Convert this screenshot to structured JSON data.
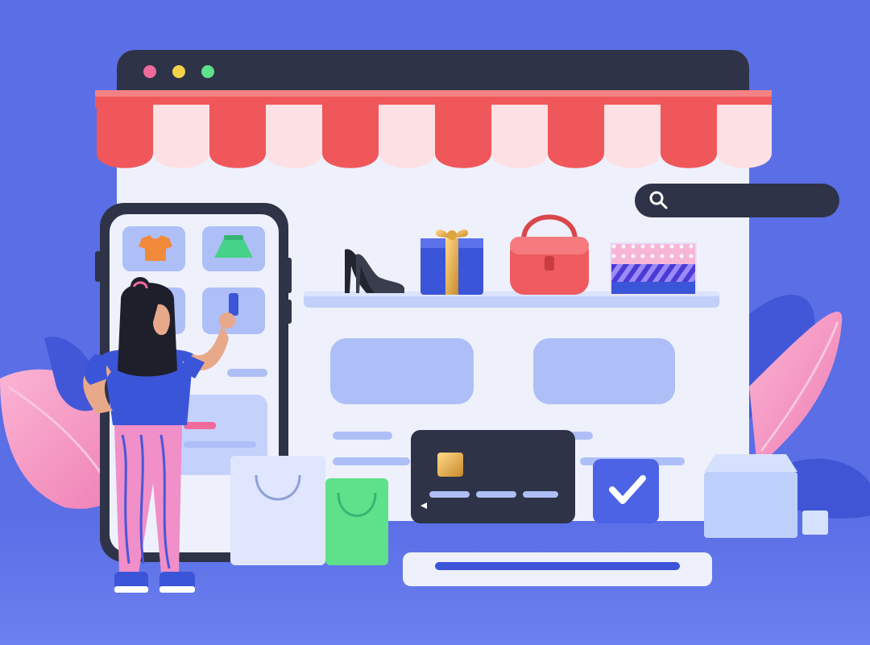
{
  "colors": {
    "background": "#5a6ee6",
    "window_bar": "#2f3347",
    "window_body": "#eef1fb",
    "dot_red": "#f06a9b",
    "dot_yellow": "#f2d24a",
    "dot_green": "#5fe08a",
    "awning_red": "#f0575b",
    "awning_light": "#fde0e3",
    "placeholder": "#aebff7",
    "pink_leaf": "#f59ac4",
    "blue_leaf": "#4257d8",
    "card_dark": "#2f3347",
    "check_bg": "#4b63e4"
  },
  "shelf_items": [
    {
      "name": "high-heel-shoe",
      "color": "#22242e"
    },
    {
      "name": "gift-box",
      "color": "#3b55d8"
    },
    {
      "name": "handbag",
      "color": "#ef5b5f"
    },
    {
      "name": "patterned-box",
      "color": "#f6b8d8"
    }
  ],
  "phone_tiles": [
    {
      "name": "tshirt-icon",
      "color": "#f08a3a"
    },
    {
      "name": "skirt-icon",
      "color": "#47d28a"
    }
  ],
  "icons": {
    "search": "search-icon",
    "check": "check-icon",
    "chip": "card-chip-icon"
  }
}
